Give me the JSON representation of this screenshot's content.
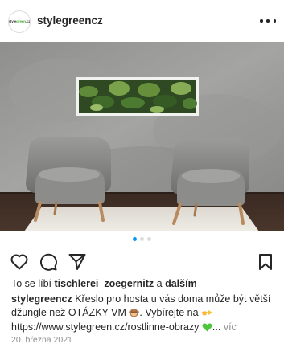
{
  "post": {
    "username": "stylegreencz",
    "avatar_logo": {
      "prefix": "style",
      "accent": "green",
      "suffix": ".cz"
    },
    "more_icon": "more-horizontal-icon"
  },
  "photo": {
    "description_icon": "photo-image"
  },
  "carousel": {
    "count": 3,
    "active_index": 0
  },
  "actions": {
    "like_icon": "heart-icon",
    "comment_icon": "comment-icon",
    "share_icon": "send-icon",
    "save_icon": "bookmark-icon"
  },
  "likes": {
    "prefix": "To se líbí",
    "user": "tischlerei_zoegernitz",
    "joiner": "a",
    "others": "dalším"
  },
  "caption": {
    "username": "stylegreencz",
    "text_1": "Křeslo pro hosta u vás doma může být větší džungle než OTÁZKY VM",
    "text_2": ". Vybírejte na",
    "text_3": "https://www.stylegreen.cz/rostlinne-obrazy",
    "ellipsis": "...",
    "more_label": "víc"
  },
  "date": "20. března 2021",
  "colors": {
    "accent_blue": "#0095f6",
    "brand_green": "#46a832",
    "text": "#262626",
    "muted": "#8e8e8e"
  }
}
